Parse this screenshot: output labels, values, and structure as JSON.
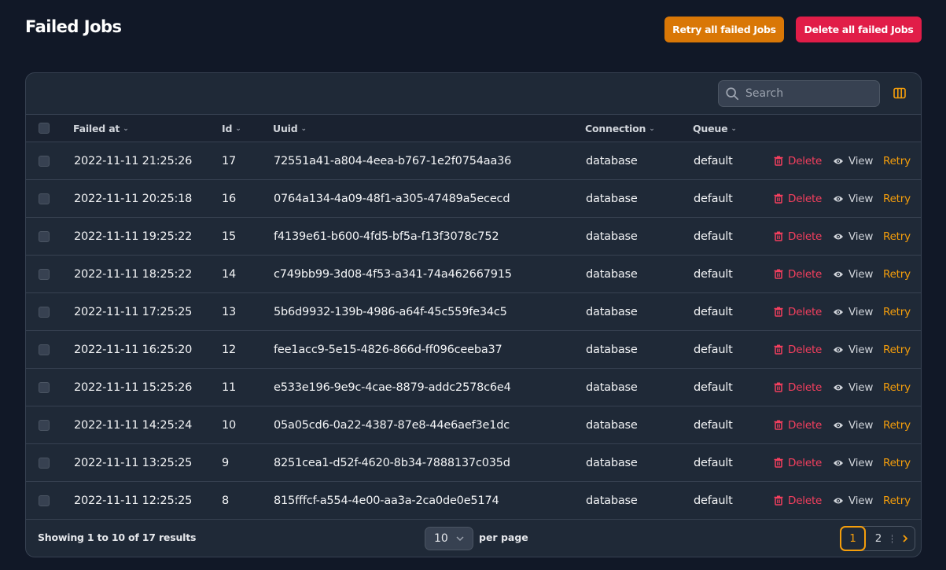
{
  "page": {
    "title": "Failed Jobs"
  },
  "header_actions": {
    "retry_all": "Retry all failed Jobs",
    "delete_all": "Delete all failed Jobs"
  },
  "toolbar": {
    "search_placeholder": "Search",
    "column_toggle_icon": "columns-icon"
  },
  "columns": {
    "failed_at": "Failed at",
    "id": "Id",
    "uuid": "Uuid",
    "connection": "Connection",
    "queue": "Queue"
  },
  "actions": {
    "delete": "Delete",
    "view": "View",
    "retry": "Retry"
  },
  "rows": [
    {
      "failed_at": "2022-11-11 21:25:26",
      "id": "17",
      "uuid": "72551a41-a804-4eea-b767-1e2f0754aa36",
      "connection": "database",
      "queue": "default"
    },
    {
      "failed_at": "2022-11-11 20:25:18",
      "id": "16",
      "uuid": "0764a134-4a09-48f1-a305-47489a5ececd",
      "connection": "database",
      "queue": "default"
    },
    {
      "failed_at": "2022-11-11 19:25:22",
      "id": "15",
      "uuid": "f4139e61-b600-4fd5-bf5a-f13f3078c752",
      "connection": "database",
      "queue": "default"
    },
    {
      "failed_at": "2022-11-11 18:25:22",
      "id": "14",
      "uuid": "c749bb99-3d08-4f53-a341-74a462667915",
      "connection": "database",
      "queue": "default"
    },
    {
      "failed_at": "2022-11-11 17:25:25",
      "id": "13",
      "uuid": "5b6d9932-139b-4986-a64f-45c559fe34c5",
      "connection": "database",
      "queue": "default"
    },
    {
      "failed_at": "2022-11-11 16:25:20",
      "id": "12",
      "uuid": "fee1acc9-5e15-4826-866d-ff096ceeba37",
      "connection": "database",
      "queue": "default"
    },
    {
      "failed_at": "2022-11-11 15:25:26",
      "id": "11",
      "uuid": "e533e196-9e9c-4cae-8879-addc2578c6e4",
      "connection": "database",
      "queue": "default"
    },
    {
      "failed_at": "2022-11-11 14:25:24",
      "id": "10",
      "uuid": "05a05cd6-0a22-4387-87e8-44e6aef3e1dc",
      "connection": "database",
      "queue": "default"
    },
    {
      "failed_at": "2022-11-11 13:25:25",
      "id": "9",
      "uuid": "8251cea1-d52f-4620-8b34-7888137c035d",
      "connection": "database",
      "queue": "default"
    },
    {
      "failed_at": "2022-11-11 12:25:25",
      "id": "8",
      "uuid": "815fffcf-a554-4e00-aa3a-2ca0de0e5174",
      "connection": "database",
      "queue": "default"
    }
  ],
  "footer": {
    "showing": "Showing 1 to 10 of 17 results",
    "per_page_value": "10",
    "per_page_label": "per page"
  },
  "pagination": {
    "pages": [
      "1",
      "2"
    ],
    "current": "1"
  },
  "colors": {
    "background": "#111827",
    "card": "#1f2937",
    "retry_all_button": "#d97706",
    "delete_all_button": "#e11d48",
    "delete_text": "#f43f5e",
    "retry_text": "#f59e0b"
  }
}
